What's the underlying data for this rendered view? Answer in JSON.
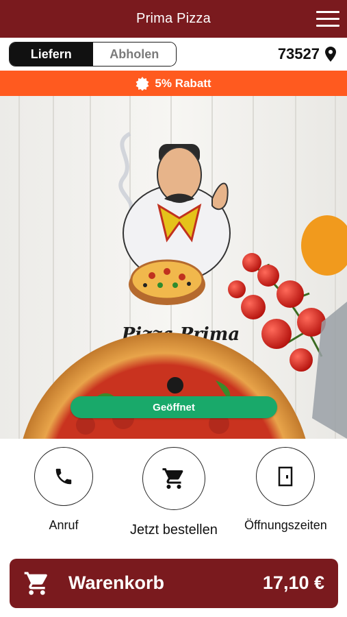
{
  "header": {
    "title": "Prima Pizza",
    "menu_icon": "hamburger-menu-icon"
  },
  "mode": {
    "options": [
      "Liefern",
      "Abholen"
    ],
    "selected": "Liefern"
  },
  "location": {
    "zip": "73527",
    "icon": "location-pin-icon"
  },
  "discount": {
    "text": "5% Rabatt",
    "icon": "badge-icon",
    "color": "#ff5a1f"
  },
  "hero": {
    "logo_text": "Pizza Prima",
    "status_label": "Geöffnet",
    "status_color": "#19a96a"
  },
  "actions": [
    {
      "label": "Anruf",
      "icon": "phone-icon"
    },
    {
      "label": "Jetzt bestellen",
      "icon": "cart-icon"
    },
    {
      "label": "Öffnungszeiten",
      "icon": "door-icon"
    }
  ],
  "cart": {
    "label": "Warenkorb",
    "total": "17,10 €",
    "icon": "cart-icon"
  },
  "colors": {
    "brand": "#7a1a1e",
    "accent": "#ff5a1f",
    "open": "#19a96a"
  }
}
